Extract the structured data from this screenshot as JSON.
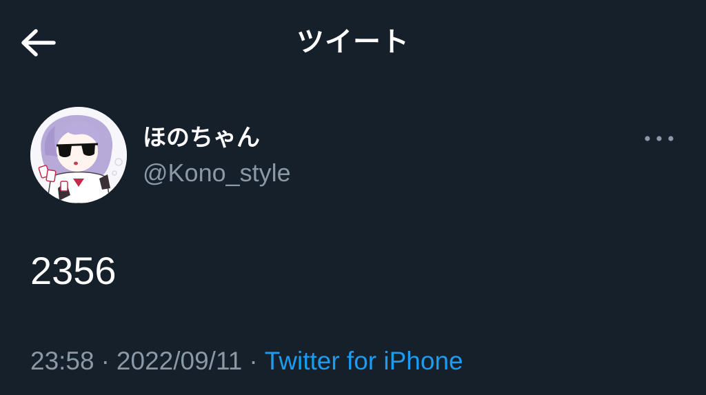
{
  "header": {
    "title": "ツイート"
  },
  "author": {
    "display_name": "ほのちゃん",
    "username": "@Kono_style"
  },
  "tweet": {
    "text": "2356",
    "time": "23:58",
    "separator": "·",
    "date": "2022/09/11",
    "source": "Twitter for iPhone"
  },
  "icons": {
    "back": "back-arrow-icon",
    "more": "more-dots-icon"
  },
  "colors": {
    "background": "#15202b",
    "text_primary": "#ffffff",
    "text_secondary": "#8b98a5",
    "accent": "#1d9bf0"
  }
}
